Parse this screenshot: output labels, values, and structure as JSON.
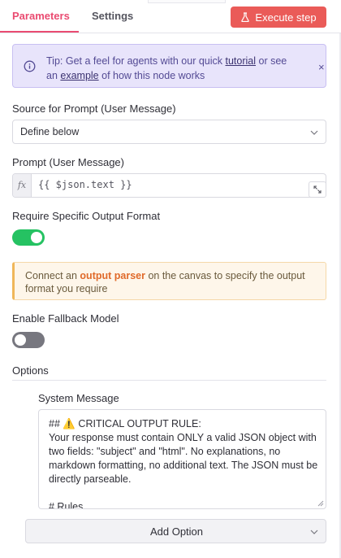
{
  "tabs": [
    {
      "label": "Parameters",
      "active": true
    },
    {
      "label": "Settings",
      "active": false
    }
  ],
  "execute_button": {
    "label": "Execute step",
    "icon": "flask-icon",
    "color": "#ea5b58"
  },
  "tip": {
    "prefix": "Tip: Get a feel for agents with our quick ",
    "link1": "tutorial",
    "middle": " or see an ",
    "link2": "example",
    "suffix": " of how this node works",
    "close": "×"
  },
  "source": {
    "label": "Source for Prompt (User Message)",
    "value": "Define below"
  },
  "prompt": {
    "label": "Prompt (User Message)",
    "fx": "fx",
    "value": "{{ $json.text }}"
  },
  "require_format": {
    "label": "Require Specific Output Format",
    "enabled": true
  },
  "warning": {
    "prefix": "Connect an ",
    "highlight": "output parser",
    "suffix": " on the canvas to specify the output format you require"
  },
  "fallback": {
    "label": "Enable Fallback Model",
    "enabled": false
  },
  "options": {
    "label": "Options",
    "system_message_label": "System Message",
    "system_message_value": "## ⚠️ CRITICAL OUTPUT RULE:\nYour response must contain ONLY a valid JSON object with two fields: \"subject\" and \"html\". No explanations, no markdown formatting, no additional text. The JSON must be directly parseable.\n\n# Rules",
    "add_option_label": "Add Option"
  },
  "colors": {
    "accent": "#ea4b71",
    "toggle_on": "#25c262",
    "toggle_off": "#77777f",
    "tip_bg": "#e8e4fb",
    "warning_highlight": "#e06a2a"
  }
}
